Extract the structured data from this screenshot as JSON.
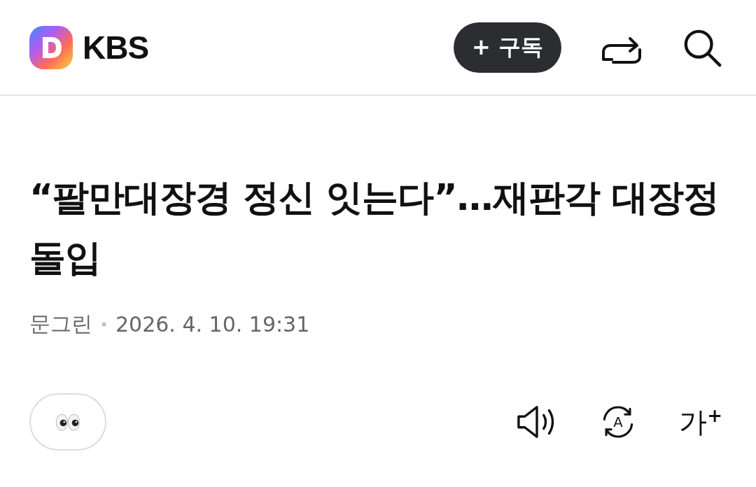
{
  "header": {
    "brand": "KBS",
    "subscribe_button": "+ 구독"
  },
  "article": {
    "title": "“팔만대장경 정신 잇는다”…재판각 대장정 돌입",
    "author": "문그린",
    "date": "2026. 4. 10. 19:31"
  },
  "toolbar": {
    "translate_label": "A",
    "font_size_button": "가$^{+}$"
  }
}
